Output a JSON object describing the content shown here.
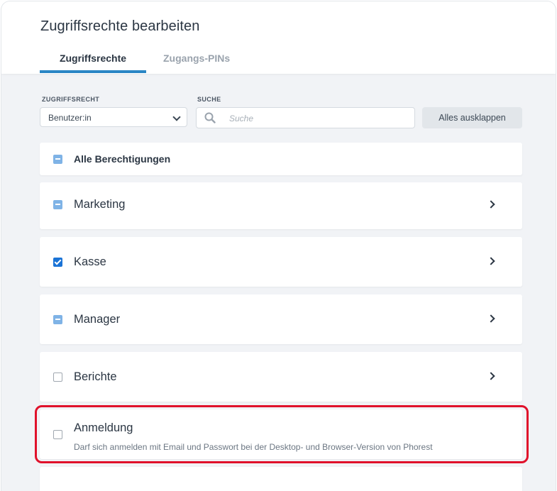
{
  "dialog": {
    "title": "Zugriffsrechte bearbeiten",
    "tabs": [
      {
        "label": "Zugriffsrechte",
        "active": true
      },
      {
        "label": "Zugangs-PINs",
        "active": false
      }
    ]
  },
  "filters": {
    "role_label": "ZUGRIFFSRECHT",
    "role_value": "Benutzer:in",
    "search_label": "SUCHE",
    "search_placeholder": "Suche",
    "expand_all": "Alles ausklappen"
  },
  "permissions": [
    {
      "label": "Alle Berechtigungen",
      "state": "partial"
    },
    {
      "label": "Marketing",
      "state": "partial"
    },
    {
      "label": "Kasse",
      "state": "checked"
    },
    {
      "label": "Manager",
      "state": "partial"
    },
    {
      "label": "Berichte",
      "state": "unchecked"
    },
    {
      "label": "Anmeldung",
      "state": "unchecked",
      "description": "Darf sich anmelden mit Email und Passwort bei der Desktop- und Browser-Version von Phorest"
    }
  ],
  "colors": {
    "accent": "#2a86c5",
    "checkbox_checked": "#1a73d6",
    "checkbox_partial": "#7fb3e6",
    "highlight": "#e0112b"
  }
}
